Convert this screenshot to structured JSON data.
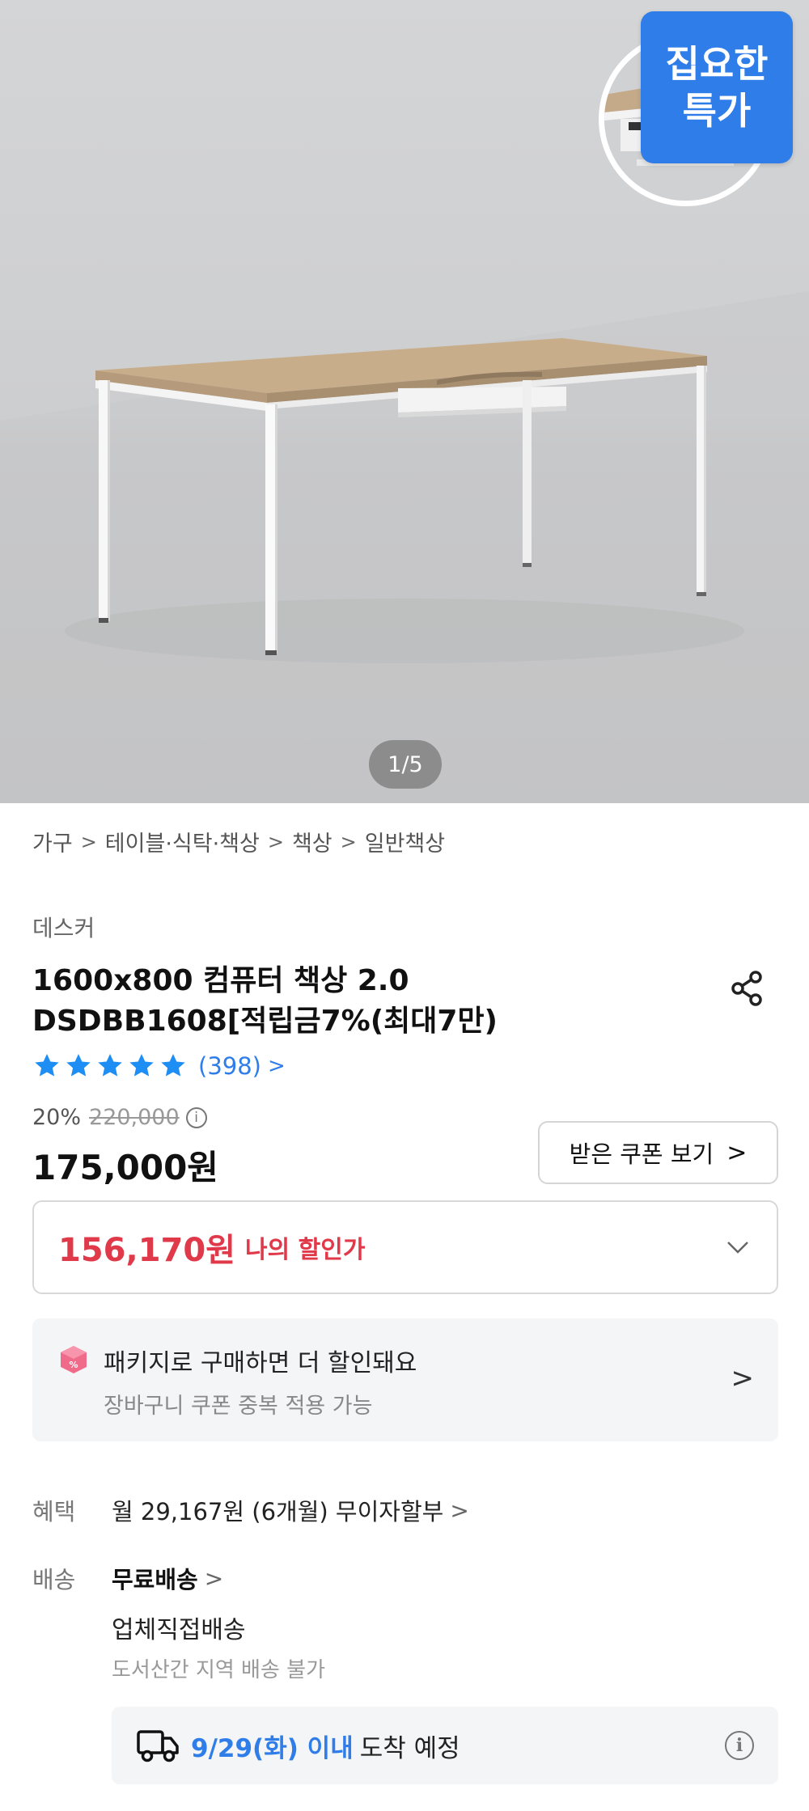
{
  "hero": {
    "image_alt": "1600x800 컴퓨터 책상",
    "deal_badge": {
      "line1": "집요한",
      "line2": "특가"
    },
    "page_indicator": "1/5"
  },
  "breadcrumb": [
    "가구",
    "테이블·식탁·책상",
    "책상",
    "일반책상"
  ],
  "product": {
    "brand": "데스커",
    "title_line1": "1600x800 컴퓨터 책상 2.0",
    "title_line2": "DSDBB1608[적립금7%(최대7만)",
    "rating_stars": 5,
    "review_count": "(398)",
    "discount_rate": "20%",
    "original_price": "220,000",
    "price": "175,000원",
    "coupon_button": "받은 쿠폰 보기",
    "my_price": {
      "amount": "156,170원",
      "label": "나의 할인가"
    }
  },
  "package": {
    "line1": "패키지로 구매하면 더 할인돼요",
    "line2": "장바구니 쿠폰 중복 적용 가능"
  },
  "benefit": {
    "label": "혜택",
    "value": "월 29,167원 (6개월) 무이자할부"
  },
  "shipping": {
    "label": "배송",
    "value": "무료배송",
    "method": "업체직접배송",
    "note": "도서산간 지역 배송 불가",
    "arrival_date": "9/29(화) 이내",
    "arrival_text": "도착 예정"
  },
  "colors": {
    "accent_blue": "#2f7de8",
    "discount_red": "#e0394a",
    "star_blue": "#1e8ef5"
  },
  "icons": [
    "share-icon",
    "star-icon",
    "info-icon",
    "chevron-down-icon",
    "package-cube-icon",
    "chevron-right-icon",
    "truck-icon"
  ]
}
